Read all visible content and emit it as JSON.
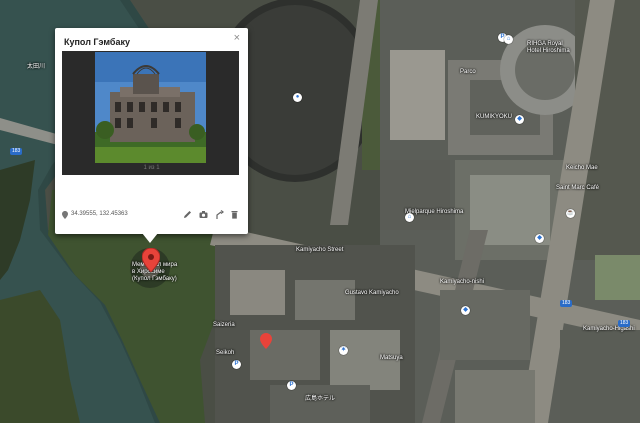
{
  "popup": {
    "title": "Купол Гэмбаку",
    "photo_counter": "1 из 1",
    "coordinates": "34.39555, 132.45363",
    "tools": [
      "edit-icon",
      "camera-icon",
      "directions-icon",
      "delete-icon"
    ]
  },
  "labels": {
    "memorial": "Мемориал мира\nв Хиросиме\n(Купол Гэмбаку)",
    "river": "太田川",
    "mielparque": "Mielparque Hiroshima",
    "rihga": "RIHGA Royal\nHotel Hiroshima",
    "kumikyoku": "KUMIKYOKU",
    "parco": "Parco",
    "keicho": "Keicho Mae",
    "cafe": "Saint Marc Café",
    "kamiyacho_west": "Kamiyacho-nishi",
    "kamiyacho_east": "Kamiyacho-Higashi",
    "kamiyacho_street": "Kamiyacho Street",
    "gustavo": "Gustavo Kamiyacho",
    "hiroshima_hotel": "広島ホテル",
    "saizeria": "Saizeria",
    "seikoh": "Seikoh",
    "matsuya": "Matsuya",
    "kamiyacho_road": "Kamiyacho-nishi"
  },
  "route_badges": [
    "183",
    "183",
    "183"
  ],
  "colors": {
    "marker_red": "#e8433a",
    "poi_blue": "#2d73d2",
    "popup_bg": "#ffffff"
  }
}
